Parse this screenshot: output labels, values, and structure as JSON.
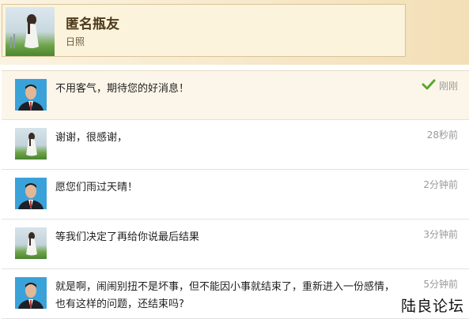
{
  "profile": {
    "name": "匿名瓶友",
    "location": "日照"
  },
  "messages": [
    {
      "avatar": "man",
      "text": "不用客气，期待您的好消息！",
      "time": "刚刚",
      "status_icon": "check-icon"
    },
    {
      "avatar": "girl",
      "text": "谢谢，很感谢，",
      "time": "28秒前"
    },
    {
      "avatar": "man",
      "text": "愿您们雨过天晴！",
      "time": "2分钟前"
    },
    {
      "avatar": "girl",
      "text": "等我们决定了再给你说最后结果",
      "time": "3分钟前"
    },
    {
      "avatar": "man",
      "text": "就是啊，闹闹别扭不是坏事，但不能因小事就结束了，重新进入一份感情，也有这样的问题，还结束吗?",
      "time": "5分钟前"
    }
  ],
  "watermark": "陆良论坛",
  "colors": {
    "check": "#5aa82c",
    "header_bg": "#fcf3dc",
    "man_avatar_bg": "#3aa2d9"
  }
}
